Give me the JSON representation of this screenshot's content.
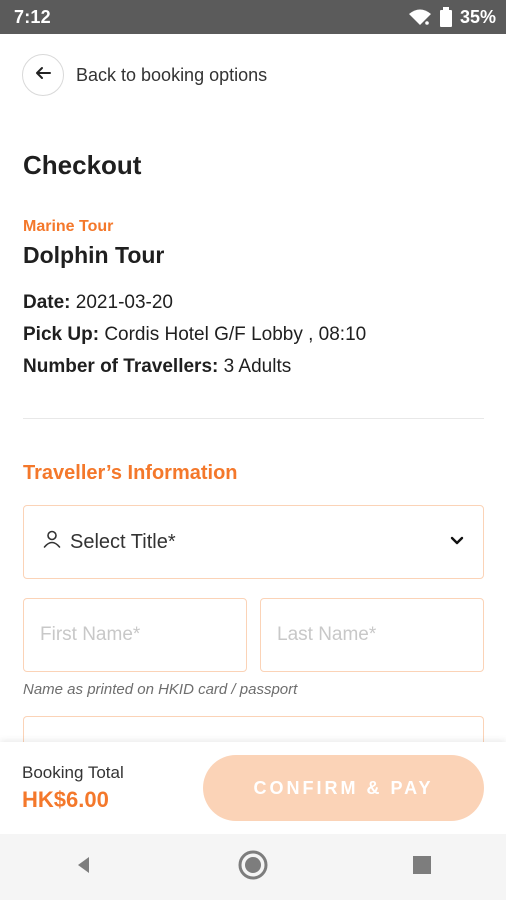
{
  "status_bar": {
    "time": "7:12",
    "battery": "35%",
    "icons": [
      "wifi-icon",
      "battery-icon"
    ]
  },
  "header": {
    "back_label": "Back to booking options",
    "back_icon": "arrow-left-icon"
  },
  "page": {
    "title": "Checkout"
  },
  "booking": {
    "category": "Marine Tour",
    "tour_name": "Dolphin Tour",
    "date_label": "Date:",
    "date_value": "2021-03-20",
    "pickup_label": "Pick Up:",
    "pickup_value": "Cordis Hotel G/F Lobby , 08:10",
    "travellers_label": "Number of Travellers:",
    "travellers_value": "3 Adults"
  },
  "traveller_info": {
    "section_title": "Traveller’s Information",
    "title_select_label": "Select Title*",
    "first_name_placeholder": "First Name*",
    "last_name_placeholder": "Last Name*",
    "name_hint": "Name as printed on HKID card / passport"
  },
  "footer": {
    "booking_total_label": "Booking Total",
    "booking_total_value": "HK$6.00",
    "confirm_label": "CONFIRM & PAY"
  },
  "colors": {
    "accent": "#f4782b",
    "disabled_button": "#fbd3b7"
  }
}
